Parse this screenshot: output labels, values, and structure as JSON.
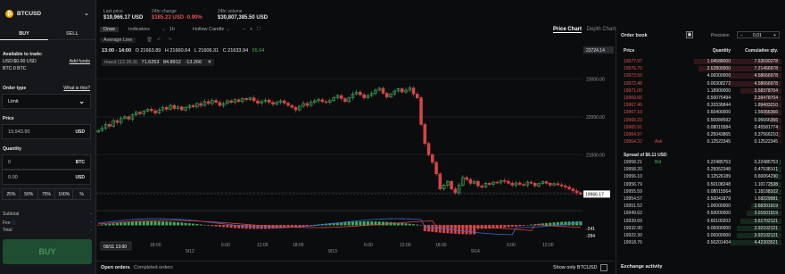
{
  "symbol": {
    "name": "BTCUSD",
    "coin": "₿"
  },
  "tabs": {
    "buy": "BUY",
    "sell": "SELL"
  },
  "balance": {
    "title": "Available to trade:",
    "usd": "USD:$0.00 USD",
    "btc": "BTC:0 BTC",
    "add_funds": "Add funds"
  },
  "order_type": {
    "label": "Order type",
    "help": "What is this?",
    "value": "Limit"
  },
  "price": {
    "label": "Price",
    "value": "19,943.90",
    "unit": "USD"
  },
  "quantity": {
    "label": "Quantity",
    "btc_value": "0",
    "btc_unit": "BTC",
    "usd_value": "0.00",
    "usd_unit": "USD"
  },
  "percent_buttons": [
    "25%",
    "50%",
    "75%",
    "100%",
    "%"
  ],
  "summary": {
    "subtotal": "Subtotal",
    "fee": "Fee",
    "total": "Total",
    "dash": "-"
  },
  "buy_button": "BUY",
  "header": {
    "last_price_label": "Last price",
    "last_price": "$19,966.17 USD",
    "change_label": "24hr change",
    "change": "$185.23 USD -0.90%",
    "volume_label": "24hr volume",
    "volume": "$30,807,385.50 USD"
  },
  "toolbar": {
    "draw": "Draw",
    "indicators": "Indicators",
    "interval": "1h",
    "candle": "Hollow Candle",
    "average_line": "Average Line"
  },
  "ohlc": {
    "time": "13:00 - 14:00",
    "o": "O 21663.89",
    "h": "H 21660.64",
    "l": "L 21606.31",
    "c": "C 21633.94",
    "chg": "55.64"
  },
  "macd": {
    "name": "macd (12,26,9)",
    "v1": "71.6253",
    "v2": "84.8912",
    "v3": "-13.266"
  },
  "chart_tabs": {
    "price_chart": "Price Chart",
    "depth_chart": "Depth Chart"
  },
  "chart_data": {
    "type": "candlestick",
    "y_ticks": [
      23000,
      22000,
      21000,
      20000
    ],
    "y_tick_labels": [
      "23000.00",
      "22000.00",
      "21000.00",
      "20000.00"
    ],
    "current_price_tag": "23724.14",
    "last_price_tag": "19966.17",
    "x_labels": [
      "18:00",
      "9/12",
      "6:00",
      "12:00",
      "18:00",
      "9/13",
      "6:00",
      "12:00",
      "18:00",
      "9/14",
      "6:00",
      "12:00"
    ],
    "cursor_label": "09/11 13:00",
    "macd_tags": [
      "-241",
      "-284"
    ],
    "closes": [
      21640,
      21700,
      21800,
      21750,
      21900,
      21850,
      21960,
      22000,
      21940,
      22050,
      22120,
      22080,
      22150,
      22200,
      22160,
      22100,
      22180,
      22250,
      22200,
      22300,
      22220,
      22260,
      22180,
      22240,
      22300,
      22260,
      22350,
      22300,
      22400,
      22350,
      22430,
      22380,
      22300,
      22350,
      22420,
      22380,
      22450,
      22400,
      22480,
      22450,
      22500,
      22420,
      22360,
      22400,
      22440,
      22380,
      22330,
      22380,
      22420,
      22360,
      22300,
      22250,
      22180,
      22280,
      22350,
      22300,
      22380,
      22420,
      22450,
      22400,
      22380,
      22430,
      22500,
      22560,
      22480,
      22400,
      22500,
      22600,
      22650,
      22580,
      22500,
      22560,
      22620,
      22700,
      22750,
      22620,
      22520,
      22600,
      22680,
      22740,
      22650,
      22700,
      22760,
      22600,
      22500,
      21800,
      21300,
      21000,
      20800,
      20500,
      20100,
      20200,
      20300,
      20100,
      20000,
      20200,
      20400,
      20350,
      20250,
      20300,
      20180,
      20150,
      20250,
      20220,
      20280,
      20260,
      20320,
      20300,
      20250,
      20200,
      20260,
      20220,
      20200,
      20280,
      20250,
      20180,
      20240,
      20290,
      20250,
      20200,
      20240,
      20210,
      20180,
      20150,
      20100,
      20050,
      20000,
      19966
    ]
  },
  "orderbook": {
    "title": "Order book",
    "precision_label": "Precision",
    "precision_value": "0.01",
    "headers": {
      "price": "Price",
      "qty": "Quantity",
      "cum": "Cumulative qty."
    },
    "asks": [
      {
        "p": "19977.97",
        "q": "1.04588000",
        "c": "7.63590278"
      },
      {
        "p": "19976.70",
        "q": "2.62800000",
        "c": "7.21466978"
      },
      {
        "p": "19973.50",
        "q": "4.00000000",
        "c": "4.58666978"
      },
      {
        "p": "19972.48",
        "q": "0.00308272",
        "c": "4.58666978"
      },
      {
        "p": "19971.00",
        "q": "1.18900000",
        "c": "3.58378704"
      },
      {
        "p": "19969.66",
        "q": "0.50075494",
        "c": "2.39478704"
      },
      {
        "p": "19967.46",
        "q": "0.33336844",
        "c": "1.89403210"
      },
      {
        "p": "19967.10",
        "q": "0.60400000",
        "c": "1.56066366"
      },
      {
        "p": "19966.23",
        "q": "0.50084592",
        "c": "0.95666366"
      },
      {
        "p": "19965.91",
        "q": "0.08015584",
        "c": "0.45581774"
      },
      {
        "p": "19964.97",
        "q": "0.25043865",
        "c": "0.37566210"
      },
      {
        "p": "19964.32",
        "q": "0.12522345",
        "c": "0.12522345",
        "tag": "Ask"
      }
    ],
    "spread": "Spread of $6.11 USD",
    "bids": [
      {
        "p": "19958.21",
        "q": "0.22485753",
        "c": "0.22485753",
        "tag": "Bid"
      },
      {
        "p": "19958.20",
        "q": "0.25052348",
        "c": "0.47538101"
      },
      {
        "p": "19956.10",
        "q": "0.12526189",
        "c": "0.60064290"
      },
      {
        "p": "19956.79",
        "q": "0.50108248",
        "c": "1.10172538"
      },
      {
        "p": "19955.59",
        "q": "0.08015564",
        "c": "1.18188102"
      },
      {
        "p": "19954.57",
        "q": "0.50041879",
        "c": "1.68229981"
      },
      {
        "p": "19951.52",
        "q": "1.00000000",
        "c": "2.68301919"
      },
      {
        "p": "19949.62",
        "q": "0.50000000",
        "c": "3.01601919"
      },
      {
        "p": "19939.69",
        "q": "0.60100202",
        "c": "3.61702121"
      },
      {
        "p": "19932.90",
        "q": "0.00000000",
        "c": "3.92102121"
      },
      {
        "p": "19922.30",
        "q": "0.00000000",
        "c": "3.92102121"
      },
      {
        "p": "19918.76",
        "q": "0.50201404",
        "c": "4.42303521"
      }
    ],
    "exchange_activity": "Exchange activity"
  },
  "bottom": {
    "open_orders": "Open orders",
    "completed_orders": "Completed orders",
    "show_only": "Show only BTCUSD"
  }
}
